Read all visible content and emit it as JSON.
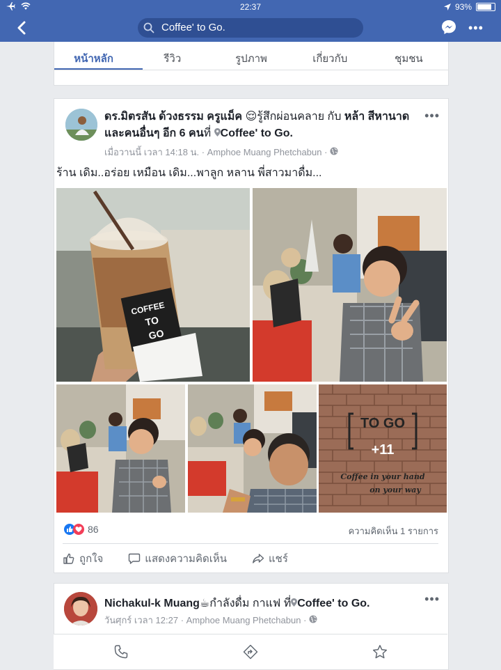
{
  "status_bar": {
    "time": "22:37",
    "battery": "93%",
    "battery_level": 0.93
  },
  "header": {
    "search_value": "Coffee' to Go."
  },
  "page_tabs": [
    "หน้าหลัก",
    "รีวิว",
    "รูปภาพ",
    "เกี่ยวกับ",
    "ชุมชน"
  ],
  "post": {
    "author": "ดร.มิตรสัน ด้วงธรรม ครูแม็ค",
    "feeling_prefix": "😌",
    "feeling": "รู้สึกผ่อนคลาย",
    "with_word": "กับ",
    "tagged": "หล้า สีหานาด",
    "and_others": "และคนอื่นๆ อีก 6 คน",
    "at_word": "ที่",
    "place": "Coffee' to Go.",
    "time": "เมื่อวานนี้ เวลา 14:18 น.",
    "location": "Amphoe Muang Phetchabun",
    "text": "ร้าน เดิม..อร่อย เหมือน เดิม...พาลูก หลาน พี่สาวมาดื่ม...",
    "photo_text": {
      "cup_brand_top": "COFFEE",
      "cup_brand_mid": "TO",
      "cup_brand_bot": "GO",
      "more_photos": "+11",
      "wall_line1": "Coffee in your hand",
      "wall_line2": "on your way",
      "wall_sign": "TO GO"
    },
    "reaction_count": "86",
    "comments": "ความคิดเห็น 1 รายการ",
    "actions": {
      "like": "ถูกใจ",
      "comment": "แสดงความคิดเห็น",
      "share": "แชร์"
    }
  },
  "post2": {
    "author": "Nichakul-k Muang",
    "activity_icon": "☕",
    "activity": "กำลังดื่ม กาแฟ",
    "at_word": "ที่",
    "place": "Coffee' to Go.",
    "time": "วันศุกร์ เวลา 12:27",
    "location": "Amphoe Muang Phetchabun"
  },
  "colors": {
    "brand": "#4267b2",
    "background": "#e9ebee",
    "like_blue": "#1877f2",
    "love_red": "#f33e58"
  },
  "icons": {
    "back": "chevron-left-icon",
    "search": "search-icon",
    "messenger": "messenger-icon",
    "more": "more-icon",
    "phone": "phone-icon",
    "directions": "directions-icon",
    "star": "star-icon"
  }
}
